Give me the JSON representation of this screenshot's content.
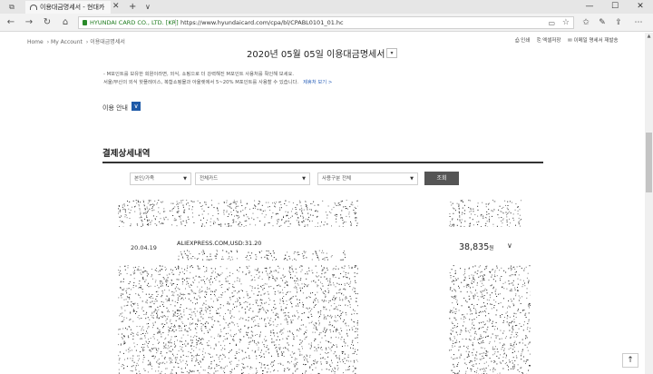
{
  "browser": {
    "tab_title": "이용대금명세서 - 현대카",
    "tab_close": "✕",
    "new_tab": "+",
    "tab_menu": "∨",
    "window": {
      "minimize": "—",
      "maximize": "☐",
      "close": "✕"
    },
    "nav": {
      "back": "←",
      "forward": "→",
      "reload": "↻",
      "home": "⌂"
    },
    "cert_label": "HYUNDAI CARD CO., LTD. [KR]",
    "url": "https://www.hyundaicard.com/cpa/bl/CPABL0101_01.hc",
    "toolbar_icons": [
      "reading-view-icon",
      "favorites-icon",
      "hub-icon",
      "notes-icon",
      "share-icon",
      "more-icon"
    ]
  },
  "page": {
    "breadcrumb": [
      "Home",
      "My Account",
      "이용대금명세서"
    ],
    "title": "2020년 05월 05일 이용대금명세서",
    "title_dropdown": "▾",
    "util_links": [
      "⎙ 인쇄",
      "⎘ 엑셀저장",
      "✉ 이메일 명세서 재발송"
    ],
    "notice_line1": "- M포인트를 보유한 회원이라면, 외식, 쇼핑으로 더 강력해진 M포인트 사용처를 확인해 보세요.",
    "notice_line2": "  서울/부산의 외식 핫플레이스, 복합쇼핑몰과 아울렛에서 5~20% M포인트를 사용할 수 있습니다.",
    "notice_more": "제휴처 보기 >",
    "usage_label": "이용 안내",
    "usage_toggle": "∨",
    "section_title": "결제상세내역",
    "filters": [
      "본인/가족",
      "전체카드",
      "사용구분 전체"
    ],
    "search_button": "조회",
    "transaction": {
      "date": "20.04.19",
      "merchant": "ALIEXPRESS.COM,USD:31.20",
      "amount": "38,835",
      "currency": "원",
      "expand": "∨"
    },
    "top_button": "↑"
  }
}
